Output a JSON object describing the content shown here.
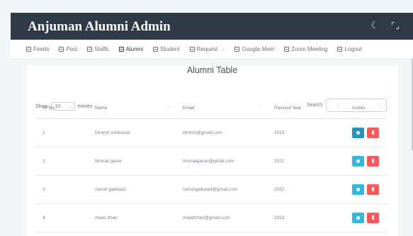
{
  "app": {
    "title": "Anjuman Alumni Admin"
  },
  "nav": {
    "items": [
      {
        "label": "Feeds",
        "active": false
      },
      {
        "label": "Post",
        "active": false
      },
      {
        "label": "Staffs",
        "active": false
      },
      {
        "label": "Alumni",
        "active": true
      },
      {
        "label": "Student",
        "active": false
      },
      {
        "label": "Request",
        "active": false,
        "dropdown": true
      },
      {
        "label": "Google Meet",
        "active": false
      },
      {
        "label": "Zoom Meeting",
        "active": false
      },
      {
        "label": "Logout",
        "active": false
      }
    ]
  },
  "table": {
    "title": "Alumni Table",
    "show_label": "Show",
    "entries_label": "entries",
    "length_value": "10",
    "search_label": "Search:",
    "columns": [
      "Sr No.",
      "Name",
      "Email",
      "Passout Year",
      "Action"
    ],
    "rows": [
      {
        "sr": "1",
        "name": "Dinesh sonkuwar",
        "email": "dinesh@gmail.com",
        "year": "2023"
      },
      {
        "sr": "2",
        "name": "Mrunal ganer",
        "email": "mrunalganer@gmail.com",
        "year": "2021"
      },
      {
        "sr": "3",
        "name": "vansh gaikwad",
        "email": "vanshgaikwad@gmail.com",
        "year": "2022"
      },
      {
        "sr": "4",
        "name": "maaz khan",
        "email": "maazkhan@gmail.com",
        "year": "2023"
      }
    ]
  },
  "icons": {
    "theme": "moon-icon",
    "fullscreen": "fullscreen-icon",
    "view": "eye-icon",
    "delete": "trash-icon"
  },
  "colors": {
    "topbar": "#303946",
    "view_button": "#38b6e0",
    "delete_button": "#f45b5b"
  }
}
